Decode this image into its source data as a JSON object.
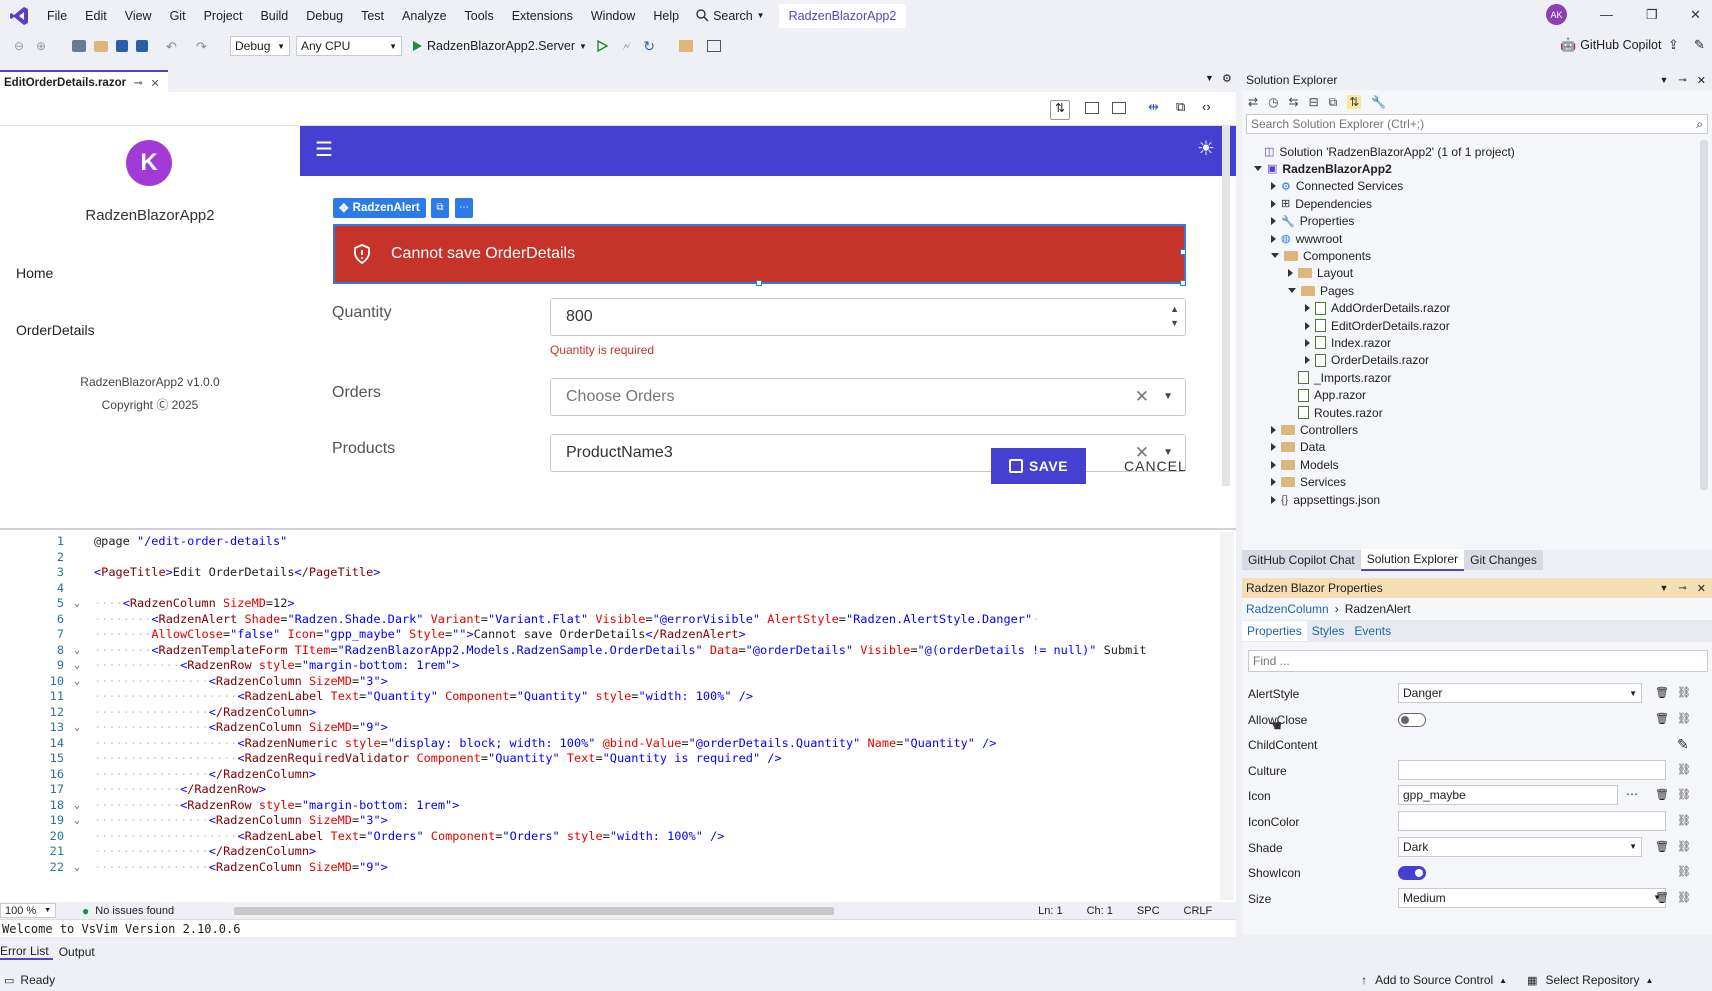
{
  "titlebar": {
    "menu": [
      "File",
      "Edit",
      "View",
      "Git",
      "Project",
      "Build",
      "Debug",
      "Test",
      "Analyze",
      "Tools",
      "Extensions",
      "Window",
      "Help"
    ],
    "search_label": "Search",
    "project_name": "RadzenBlazorApp2",
    "avatar_initials": "AK",
    "accent": "#5b3fc4"
  },
  "toolbar": {
    "config": "Debug",
    "platform": "Any CPU",
    "startup": "RadzenBlazorApp2.Server",
    "copilot_label": "GitHub Copilot"
  },
  "doc_tab": {
    "name": "EditOrderDetails.razor"
  },
  "designer": {
    "app_title": "RadzenBlazorApp2",
    "nav": [
      "Home",
      "OrderDetails"
    ],
    "version": "RadzenBlazorApp2 v1.0.0",
    "copyright": "Copyright Ⓒ 2025",
    "header_color": "#4340d2",
    "component_chip": "RadzenAlert",
    "alert_text": "Cannot save OrderDetails",
    "alert_color": "#c5332a",
    "fields": [
      {
        "label": "Quantity",
        "value": "800"
      },
      {
        "label": "Orders",
        "value": "Choose Orders"
      },
      {
        "label": "Products",
        "value": "ProductName3"
      }
    ],
    "quantity_error": "Quantity is required",
    "save_label": "SAVE",
    "cancel_label": "CANCEL"
  },
  "code": {
    "lines": [
      "@page \"/edit-order-details\"",
      "",
      "<PageTitle>Edit OrderDetails</PageTitle>",
      "",
      "····<RadzenColumn SizeMD=12>",
      "········<RadzenAlert Shade=\"Radzen.Shade.Dark\" Variant=\"Variant.Flat\" Visible=\"@errorVisible\" AlertStyle=\"Radzen.AlertStyle.Danger\"·",
      "········AllowClose=\"false\" Icon=\"gpp_maybe\" Style=\"\">Cannot save OrderDetails</RadzenAlert>",
      "········<RadzenTemplateForm TItem=\"RadzenBlazorApp2.Models.RadzenSample.OrderDetails\" Data=\"@orderDetails\" Visible=\"@(orderDetails != null)\" Submit",
      "············<RadzenRow style=\"margin-bottom: 1rem\">",
      "················<RadzenColumn SizeMD=\"3\">",
      "····················<RadzenLabel Text=\"Quantity\" Component=\"Quantity\" style=\"width: 100%\" />",
      "················</RadzenColumn>",
      "················<RadzenColumn SizeMD=\"9\">",
      "····················<RadzenNumeric style=\"display: block; width: 100%\" @bind-Value=\"@orderDetails.Quantity\" Name=\"Quantity\" />",
      "····················<RadzenRequiredValidator Component=\"Quantity\" Text=\"Quantity is required\" />",
      "················</RadzenColumn>",
      "············</RadzenRow>",
      "············<RadzenRow style=\"margin-bottom: 1rem\">",
      "················<RadzenColumn SizeMD=\"3\">",
      "····················<RadzenLabel Text=\"Orders\" Component=\"Orders\" style=\"width: 100%\" />",
      "················</RadzenColumn>",
      "················<RadzenColumn SizeMD=\"9\">"
    ],
    "fold_lines": [
      5,
      8,
      9,
      10,
      13,
      18,
      19,
      22
    ],
    "zoom": "100 %",
    "issues": "No issues found",
    "ln": "Ln: 1",
    "ch": "Ch: 1",
    "spc": "SPC",
    "crlf": "CRLF",
    "vsvim": "Welcome to VsVim Version 2.10.0.6"
  },
  "bottom_tabs": [
    "Error List",
    "Output"
  ],
  "statusbar": {
    "ready": "Ready",
    "source_control": "Add to Source Control",
    "repo": "Select Repository"
  },
  "solution_explorer": {
    "title": "Solution Explorer",
    "search_placeholder": "Search Solution Explorer (Ctrl+;)",
    "items": [
      {
        "label": "Solution 'RadzenBlazorApp2' (1 of 1 project)",
        "level": 0,
        "kind": "solution",
        "exp": "none"
      },
      {
        "label": "RadzenBlazorApp2",
        "level": 0,
        "kind": "project",
        "exp": "open"
      },
      {
        "label": "Connected Services",
        "level": 1,
        "kind": "service",
        "exp": "closed"
      },
      {
        "label": "Dependencies",
        "level": 1,
        "kind": "deps",
        "exp": "closed"
      },
      {
        "label": "Properties",
        "level": 1,
        "kind": "props",
        "exp": "closed"
      },
      {
        "label": "wwwroot",
        "level": 1,
        "kind": "globe",
        "exp": "closed"
      },
      {
        "label": "Components",
        "level": 1,
        "kind": "folder",
        "exp": "open"
      },
      {
        "label": "Layout",
        "level": 2,
        "kind": "folder",
        "exp": "closed"
      },
      {
        "label": "Pages",
        "level": 2,
        "kind": "folder",
        "exp": "open"
      },
      {
        "label": "AddOrderDetails.razor",
        "level": 3,
        "kind": "file",
        "exp": "closed"
      },
      {
        "label": "EditOrderDetails.razor",
        "level": 3,
        "kind": "file",
        "exp": "closed"
      },
      {
        "label": "Index.razor",
        "level": 3,
        "kind": "file",
        "exp": "closed"
      },
      {
        "label": "OrderDetails.razor",
        "level": 3,
        "kind": "file",
        "exp": "closed"
      },
      {
        "label": "_Imports.razor",
        "level": 2,
        "kind": "file",
        "exp": "none"
      },
      {
        "label": "App.razor",
        "level": 2,
        "kind": "file",
        "exp": "none"
      },
      {
        "label": "Routes.razor",
        "level": 2,
        "kind": "file",
        "exp": "none"
      },
      {
        "label": "Controllers",
        "level": 1,
        "kind": "folder",
        "exp": "closed"
      },
      {
        "label": "Data",
        "level": 1,
        "kind": "folder",
        "exp": "closed"
      },
      {
        "label": "Models",
        "level": 1,
        "kind": "folder",
        "exp": "closed"
      },
      {
        "label": "Services",
        "level": 1,
        "kind": "folder",
        "exp": "closed"
      },
      {
        "label": "appsettings.json",
        "level": 1,
        "kind": "json",
        "exp": "closed"
      }
    ],
    "tabs": [
      "GitHub Copilot Chat",
      "Solution Explorer",
      "Git Changes"
    ]
  },
  "properties": {
    "title": "Radzen Blazor Properties",
    "breadcrumb": [
      "RadzenColumn",
      "RadzenAlert"
    ],
    "tabs": [
      "Properties",
      "Styles",
      "Events"
    ],
    "find_placeholder": "Find ...",
    "rows": [
      {
        "name": "AlertStyle",
        "value": "Danger",
        "kind": "select"
      },
      {
        "name": "AllowClose",
        "value": "",
        "kind": "toggle-off"
      },
      {
        "name": "ChildContent",
        "value": "",
        "kind": "edit"
      },
      {
        "name": "Culture",
        "value": "",
        "kind": "text"
      },
      {
        "name": "Icon",
        "value": "gpp_maybe",
        "kind": "text-more"
      },
      {
        "name": "IconColor",
        "value": "",
        "kind": "text"
      },
      {
        "name": "Shade",
        "value": "Dark",
        "kind": "select"
      },
      {
        "name": "ShowIcon",
        "value": "",
        "kind": "toggle-on"
      },
      {
        "name": "Size",
        "value": "Medium",
        "kind": "select"
      }
    ]
  }
}
